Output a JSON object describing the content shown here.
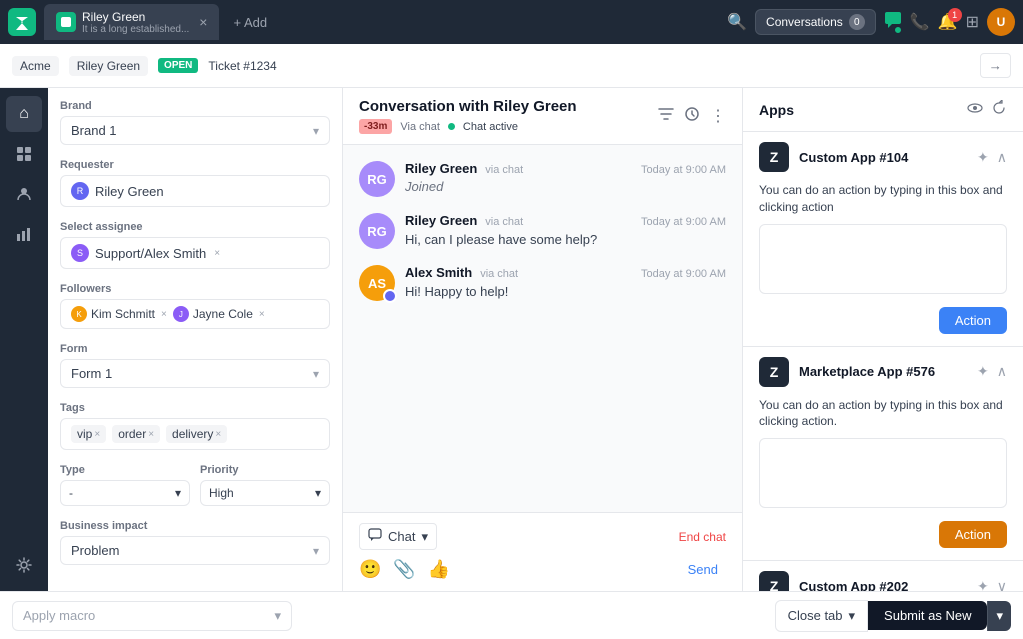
{
  "topbar": {
    "logo_text": "Z",
    "tab": {
      "title": "Riley Green",
      "subtitle": "It is a long established...",
      "close_label": "×"
    },
    "add_label": "+ Add",
    "conversations_label": "Conversations",
    "conversations_count": "0",
    "notif_count": "1"
  },
  "subheader": {
    "acme_label": "Acme",
    "riley_label": "Riley Green",
    "open_label": "OPEN",
    "ticket_label": "Ticket #1234",
    "nav_arrow": "→"
  },
  "left_sidebar": {
    "brand_label": "Brand",
    "brand_value": "Brand 1",
    "requester_label": "Requester",
    "requester_name": "Riley Green",
    "assignee_label": "Select assignee",
    "assignee_name": "Support/Alex Smith",
    "followers_label": "Followers",
    "follower1": "Kim Schmitt",
    "follower2": "Jayne Cole",
    "form_label": "Form",
    "form_value": "Form 1",
    "tags_label": "Tags",
    "tag1": "vip",
    "tag2": "order",
    "tag3": "delivery",
    "type_label": "Type",
    "type_value": "-",
    "priority_label": "Priority",
    "priority_value": "High",
    "business_impact_label": "Business impact",
    "business_impact_value": "Problem",
    "macro_placeholder": "Apply macro",
    "chevron": "▾"
  },
  "chat": {
    "title": "Conversation with Riley Green",
    "timer": "-33m",
    "via_chat": "Via chat",
    "active_label": "Chat active",
    "messages": [
      {
        "sender": "Riley Green",
        "via": "via chat",
        "time": "Today at 9:00 AM",
        "text": "Joined",
        "type": "joined",
        "avatar_bg": "#a78bfa",
        "initials": "RG"
      },
      {
        "sender": "Riley Green",
        "via": "via chat",
        "time": "Today at 9:00 AM",
        "text": "Hi, can I please have some help?",
        "type": "message",
        "avatar_bg": "#a78bfa",
        "initials": "RG"
      },
      {
        "sender": "Alex Smith",
        "via": "via chat",
        "time": "Today at 9:00 AM",
        "text": "Hi! Happy to help!",
        "type": "message",
        "avatar_bg": "#f59e0b",
        "initials": "AS"
      }
    ],
    "type_btn_label": "Chat",
    "end_chat_label": "End chat",
    "send_label": "Send"
  },
  "apps": {
    "title": "Apps",
    "app1": {
      "name": "Custom App #104",
      "desc": "You can do an action by typing in this box and clicking action",
      "btn_label": "Action",
      "btn_color": "blue"
    },
    "app2": {
      "name": "Marketplace App #576",
      "desc": "You can do an action by typing in this box and clicking action.",
      "btn_label": "Action",
      "btn_color": "gold"
    },
    "app3": {
      "name": "Custom App #202"
    }
  },
  "bottom_bar": {
    "macro_placeholder": "Apply macro",
    "close_tab_label": "Close tab",
    "chevron": "▾",
    "submit_label": "Submit as New",
    "submit_arrow": "▾"
  },
  "nav_items": {
    "home": "⌂",
    "grid": "⊞",
    "users": "👤",
    "chart": "📊",
    "gear": "⚙"
  }
}
